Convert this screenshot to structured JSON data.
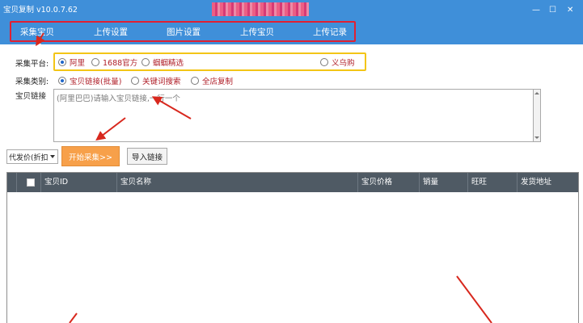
{
  "window": {
    "title": "宝贝复制 v10.0.7.62",
    "minimize": "—",
    "maximize": "☐",
    "close": "✕"
  },
  "nav": {
    "tabs": [
      {
        "label": "采集宝贝",
        "active": true
      },
      {
        "label": "上传设置",
        "active": false
      },
      {
        "label": "图片设置",
        "active": false
      },
      {
        "label": "上传宝贝",
        "active": false
      },
      {
        "label": "上传记录",
        "active": false
      }
    ]
  },
  "platform": {
    "label": "采集平台:",
    "options": [
      {
        "label": "阿里",
        "selected": true
      },
      {
        "label": "1688官方",
        "selected": false
      },
      {
        "label": "蝈蝈精选",
        "selected": false
      },
      {
        "label": "义乌购",
        "selected": false
      }
    ]
  },
  "category": {
    "label": "采集类别:",
    "options": [
      {
        "label": "宝贝链接(批量)",
        "selected": true
      },
      {
        "label": "关键词搜索",
        "selected": false
      },
      {
        "label": "全店复制",
        "selected": false
      }
    ]
  },
  "links": {
    "label": "宝贝链接",
    "placeholder": "(阿里巴巴)请输入宝贝链接,一行一个"
  },
  "toolbar": {
    "price_select": "代发价(折扣",
    "start_button": "开始采集>>",
    "import_button": "导入链接"
  },
  "table": {
    "columns": [
      "宝贝ID",
      "宝贝名称",
      "宝贝价格",
      "销量",
      "旺旺",
      "发货地址"
    ]
  },
  "colors": {
    "titlebar": "#3f8fd9",
    "highlight_red": "#e02032",
    "highlight_yellow": "#f3c517",
    "start_button": "#f7a04a",
    "grid_header": "#4f5a64"
  }
}
